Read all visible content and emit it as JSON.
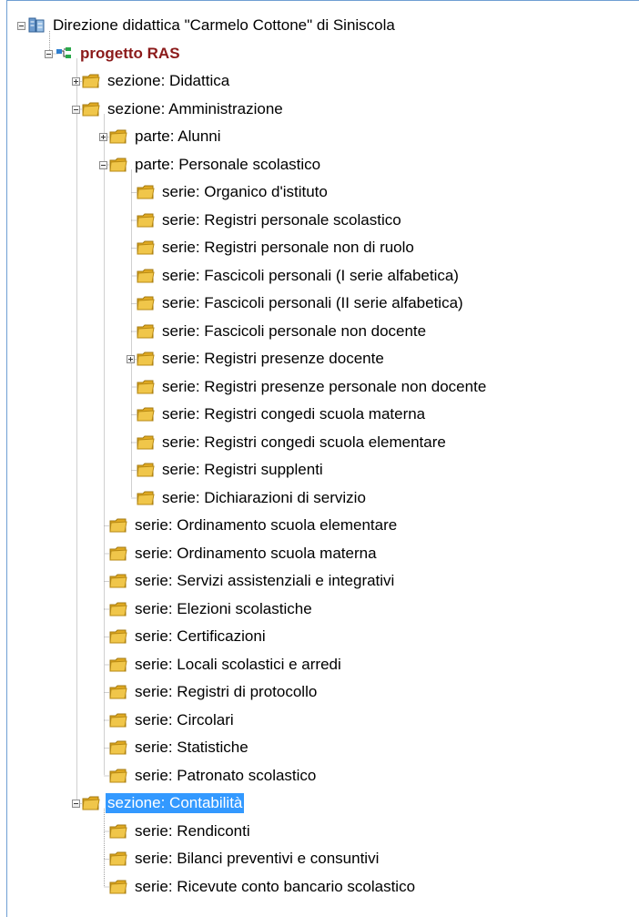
{
  "colors": {
    "selection": "#3399ff",
    "project_text": "#8b1a1a",
    "folder": "#f0c64a",
    "guide_line": "#a0a0a0",
    "frame": "#6f9fd3"
  },
  "tree": [
    {
      "id": "n1",
      "label": "Direzione didattica \"Carmelo Cottone\" di Siniscola",
      "depth": 0,
      "icon": "archive-icon",
      "expander": "minus"
    },
    {
      "id": "n2",
      "label": "progetto RAS",
      "depth": 1,
      "icon": "project-tree-icon",
      "expander": "minus",
      "bold": true
    },
    {
      "id": "n3",
      "label": "sezione: Didattica",
      "depth": 2,
      "icon": "folder-icon",
      "expander": "plus"
    },
    {
      "id": "n4",
      "label": "sezione: Amministrazione",
      "depth": 2,
      "icon": "folder-icon",
      "expander": "minus"
    },
    {
      "id": "n5",
      "label": "parte: Alunni",
      "depth": 3,
      "icon": "folder-icon",
      "expander": "plus"
    },
    {
      "id": "n6",
      "label": "parte: Personale scolastico",
      "depth": 3,
      "icon": "folder-icon",
      "expander": "minus"
    },
    {
      "id": "n7",
      "label": "serie: Organico d'istituto",
      "depth": 4,
      "icon": "folder-icon",
      "expander": "none"
    },
    {
      "id": "n8",
      "label": "serie: Registri personale scolastico",
      "depth": 4,
      "icon": "folder-icon",
      "expander": "none"
    },
    {
      "id": "n9",
      "label": "serie: Registri personale non di ruolo",
      "depth": 4,
      "icon": "folder-icon",
      "expander": "none"
    },
    {
      "id": "n10",
      "label": "serie: Fascicoli personali (I serie alfabetica)",
      "depth": 4,
      "icon": "folder-icon",
      "expander": "none"
    },
    {
      "id": "n11",
      "label": "serie: Fascicoli personali (II serie alfabetica)",
      "depth": 4,
      "icon": "folder-icon",
      "expander": "none"
    },
    {
      "id": "n12",
      "label": "serie: Fascicoli personale non docente",
      "depth": 4,
      "icon": "folder-icon",
      "expander": "none"
    },
    {
      "id": "n13",
      "label": "serie: Registri presenze docente",
      "depth": 4,
      "icon": "folder-icon",
      "expander": "plus"
    },
    {
      "id": "n14",
      "label": "serie: Registri presenze personale non docente",
      "depth": 4,
      "icon": "folder-icon",
      "expander": "none"
    },
    {
      "id": "n15",
      "label": "serie: Registri congedi scuola materna",
      "depth": 4,
      "icon": "folder-icon",
      "expander": "none"
    },
    {
      "id": "n16",
      "label": "serie: Registri congedi scuola elementare",
      "depth": 4,
      "icon": "folder-icon",
      "expander": "none"
    },
    {
      "id": "n17",
      "label": "serie: Registri supplenti",
      "depth": 4,
      "icon": "folder-icon",
      "expander": "none"
    },
    {
      "id": "n18",
      "label": "serie: Dichiarazioni di servizio",
      "depth": 4,
      "icon": "folder-icon",
      "expander": "none"
    },
    {
      "id": "n19",
      "label": "serie: Ordinamento scuola elementare",
      "depth": 3,
      "icon": "folder-icon",
      "expander": "none"
    },
    {
      "id": "n20",
      "label": "serie: Ordinamento scuola materna",
      "depth": 3,
      "icon": "folder-icon",
      "expander": "none"
    },
    {
      "id": "n21",
      "label": "serie: Servizi assistenziali e integrativi",
      "depth": 3,
      "icon": "folder-icon",
      "expander": "none"
    },
    {
      "id": "n22",
      "label": "serie: Elezioni scolastiche",
      "depth": 3,
      "icon": "folder-icon",
      "expander": "none"
    },
    {
      "id": "n23",
      "label": "serie: Certificazioni",
      "depth": 3,
      "icon": "folder-icon",
      "expander": "none"
    },
    {
      "id": "n24",
      "label": "serie: Locali scolastici e arredi",
      "depth": 3,
      "icon": "folder-icon",
      "expander": "none"
    },
    {
      "id": "n25",
      "label": "serie: Registri di protocollo",
      "depth": 3,
      "icon": "folder-icon",
      "expander": "none"
    },
    {
      "id": "n26",
      "label": "serie: Circolari",
      "depth": 3,
      "icon": "folder-icon",
      "expander": "none"
    },
    {
      "id": "n27",
      "label": "serie: Statistiche",
      "depth": 3,
      "icon": "folder-icon",
      "expander": "none"
    },
    {
      "id": "n28",
      "label": "serie: Patronato scolastico",
      "depth": 3,
      "icon": "folder-icon",
      "expander": "none"
    },
    {
      "id": "n29",
      "label": "sezione: Contabilità",
      "depth": 2,
      "icon": "folder-icon",
      "expander": "minus",
      "selected": true
    },
    {
      "id": "n30",
      "label": "serie: Rendiconti",
      "depth": 3,
      "icon": "folder-icon",
      "expander": "none"
    },
    {
      "id": "n31",
      "label": "serie: Bilanci preventivi e consuntivi",
      "depth": 3,
      "icon": "folder-icon",
      "expander": "none"
    },
    {
      "id": "n32",
      "label": "serie: Ricevute conto bancario scolastico",
      "depth": 3,
      "icon": "folder-icon",
      "expander": "none"
    }
  ]
}
